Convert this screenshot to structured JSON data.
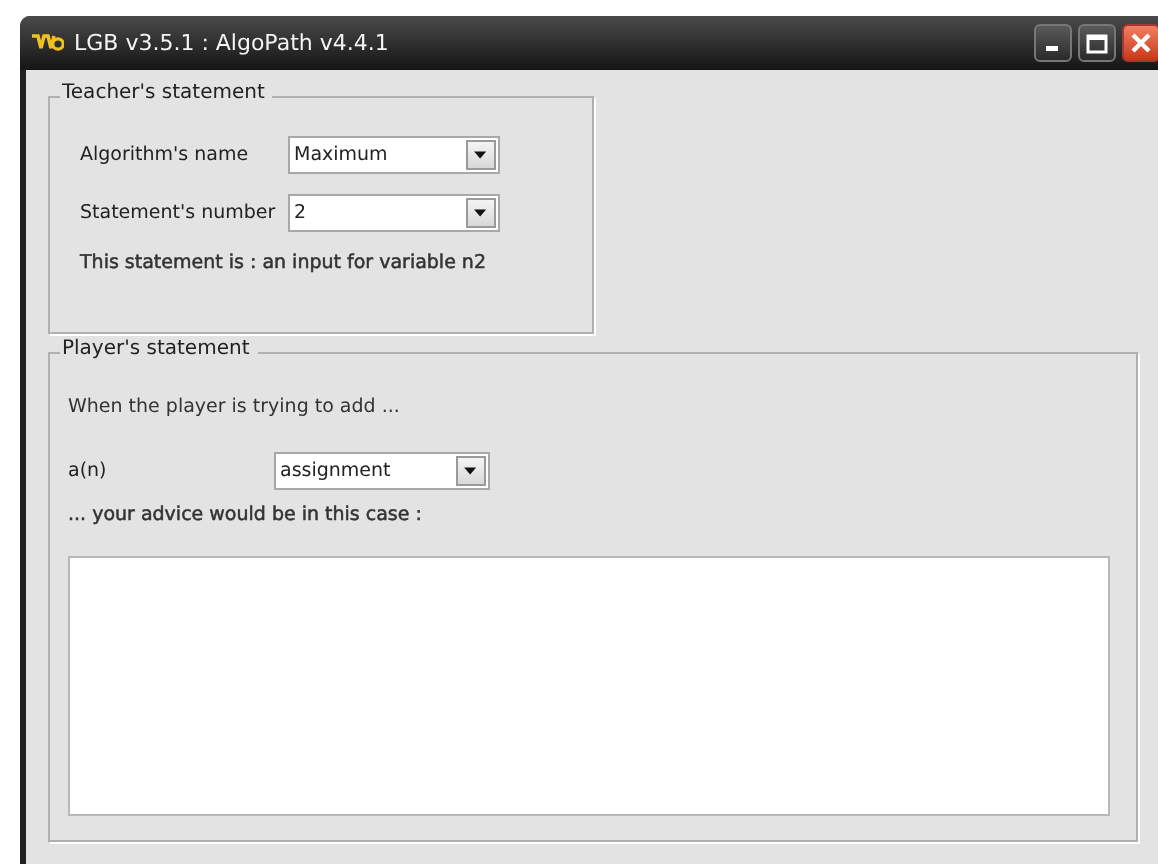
{
  "window": {
    "title": "LGB v3.5.1 : AlgoPath v4.4.1"
  },
  "teacher": {
    "legend": "Teacher's statement",
    "fields": [
      {
        "label": "Algorithm's name",
        "value": "Maximum"
      },
      {
        "label": "Statement's number",
        "value": "2"
      }
    ],
    "statement": "This statement is : an input for variable n2"
  },
  "player": {
    "legend": "Player's statement",
    "intro": "When the player is trying to add ...",
    "field": {
      "label": "a(n)",
      "value": "assignment"
    },
    "advice_label": "... your advice would be in this case :"
  }
}
